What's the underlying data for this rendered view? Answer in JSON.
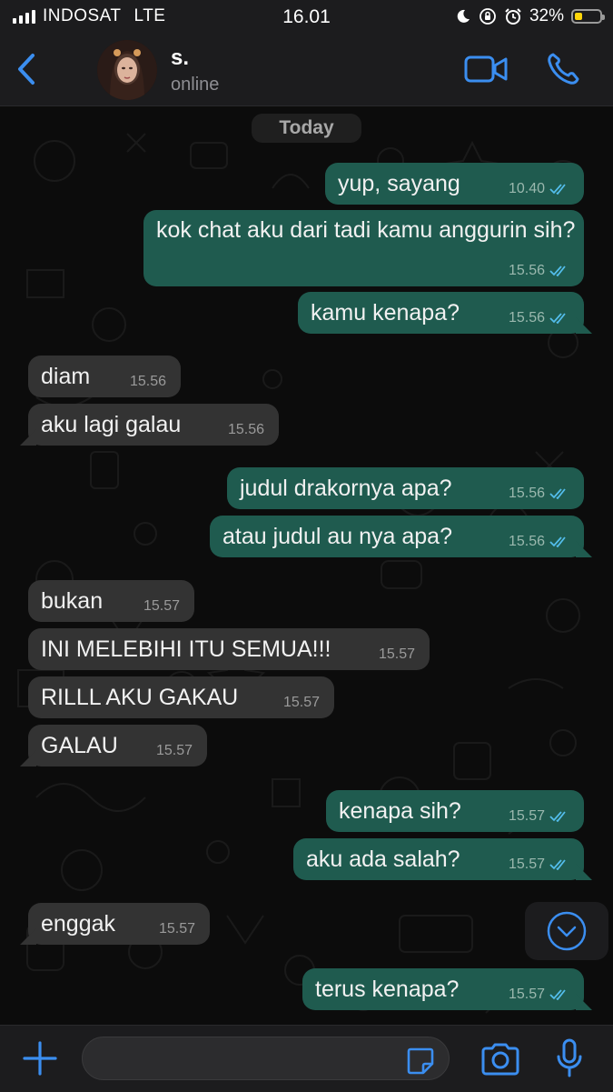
{
  "status_bar": {
    "carrier": "INDOSAT",
    "network": "LTE",
    "time": "16.01",
    "battery_percent": "32%",
    "battery_level": 0.32,
    "icons": [
      "signal-icon",
      "moon-icon",
      "orientation-lock-icon",
      "alarm-icon",
      "battery-icon"
    ]
  },
  "header": {
    "contact_name": "s.",
    "contact_status": "online",
    "icons": [
      "back-chevron-icon",
      "avatar",
      "video-call-icon",
      "phone-call-icon"
    ]
  },
  "chat": {
    "date_label": "Today",
    "messages": [
      {
        "dir": "out",
        "text": "yup, sayang",
        "time": "10.40",
        "read": true
      },
      {
        "dir": "out",
        "text": "kok chat aku dari tadi kamu anggurin sih?",
        "time": "15.56",
        "read": true
      },
      {
        "dir": "out",
        "text": "kamu kenapa?",
        "time": "15.56",
        "read": true
      },
      {
        "dir": "in",
        "text": "diam",
        "time": "15.56"
      },
      {
        "dir": "in",
        "text": "aku lagi galau",
        "time": "15.56"
      },
      {
        "dir": "out",
        "text": "judul drakornya apa?",
        "time": "15.56",
        "read": true
      },
      {
        "dir": "out",
        "text": "atau judul au nya apa?",
        "time": "15.56",
        "read": true
      },
      {
        "dir": "in",
        "text": "bukan",
        "time": "15.57"
      },
      {
        "dir": "in",
        "text": "INI MELEBIHI ITU SEMUA!!!",
        "time": "15.57"
      },
      {
        "dir": "in",
        "text": "RILLL AKU GAKAU",
        "time": "15.57"
      },
      {
        "dir": "in",
        "text": "GALAU",
        "time": "15.57"
      },
      {
        "dir": "out",
        "text": "kenapa sih?",
        "time": "15.57",
        "read": true
      },
      {
        "dir": "out",
        "text": "aku ada salah?",
        "time": "15.57",
        "read": true
      },
      {
        "dir": "in",
        "text": "enggak",
        "time": "15.57"
      },
      {
        "dir": "out",
        "text": "terus kenapa?",
        "time": "15.57",
        "read": true
      }
    ]
  },
  "input_bar": {
    "placeholder": "",
    "icons": [
      "plus-icon",
      "sticker-icon",
      "camera-icon",
      "microphone-icon"
    ]
  },
  "colors": {
    "accent": "#3b8ef0",
    "outgoing_bubble": "#1f5b4f",
    "incoming_bubble": "#333333",
    "read_ticks": "#53bdeb"
  }
}
